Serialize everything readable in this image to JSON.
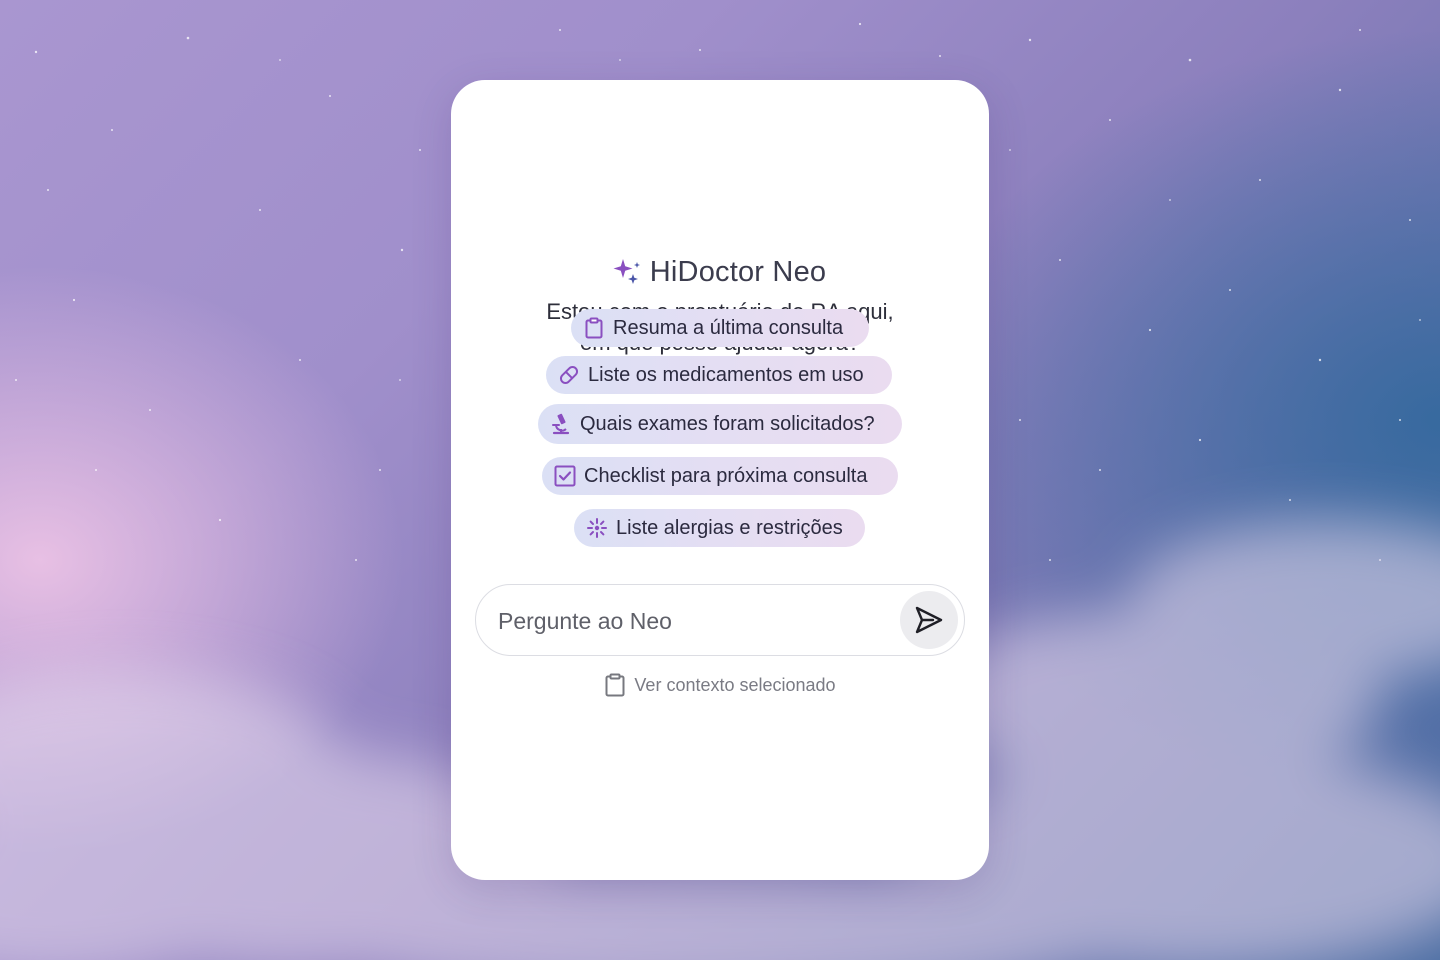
{
  "app": {
    "title": "HiDoctor Neo",
    "subtitle_line1": "Estou com o prontuário de RA aqui,",
    "subtitle_line2": "em que posso ajudar agora?"
  },
  "suggestions": [
    {
      "label": "Resuma a última consulta",
      "icon": "clipboard-icon"
    },
    {
      "label": "Liste os medicamentos em uso",
      "icon": "pill-icon"
    },
    {
      "label": "Quais exames foram solicitados?",
      "icon": "microscope-icon"
    },
    {
      "label": "Checklist para próxima consulta",
      "icon": "checkbox-icon"
    },
    {
      "label": "Liste alergias e restrições",
      "icon": "burst-icon"
    }
  ],
  "input": {
    "placeholder": "Pergunte ao Neo",
    "value": ""
  },
  "send": {
    "icon": "send-icon"
  },
  "context": {
    "label": "Ver contexto selecionado",
    "icon": "clipboard-icon"
  },
  "colors": {
    "accent": "#8a4fc0",
    "chip_bg_start": "#dbe0f5",
    "chip_bg_end": "#eadcf0",
    "card_bg": "#ffffff"
  }
}
